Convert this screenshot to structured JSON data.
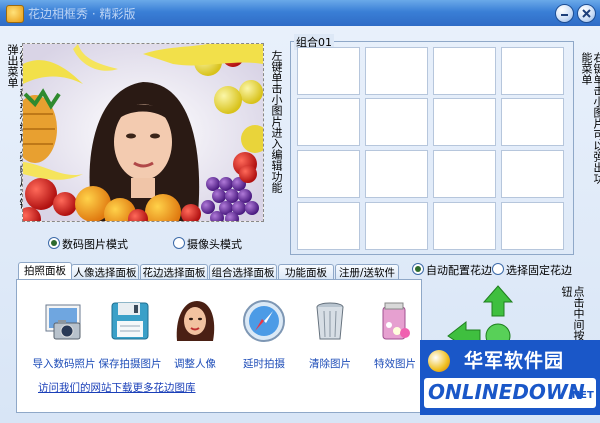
{
  "window": {
    "title": "花边相框秀 · 精彩版"
  },
  "left_hint": "左键可以移动和缩放人物照片右键弹出菜单",
  "mid_hint": "左键单击小图片进入编辑功能",
  "right_hint": "右键单击小图片可以弹出功能菜单",
  "right_hint2": "点击中间按钮",
  "group": {
    "label": "组合01"
  },
  "mode_options": [
    "数码图片模式",
    "摄像头模式"
  ],
  "mode_selected": 0,
  "border_options": [
    "自动配置花边",
    "选择固定花边"
  ],
  "border_selected": 0,
  "tabs": [
    "拍照面板",
    "人像选择面板",
    "花边选择面板",
    "组合选择面板",
    "功能面板",
    "注册/送软件"
  ],
  "tools": [
    {
      "label": "导入数码照片",
      "icon": "camera-icon"
    },
    {
      "label": "保存拍摄图片",
      "icon": "floppy-save-icon"
    },
    {
      "label": "调整人像",
      "icon": "portrait-icon"
    },
    {
      "label": "延时拍摄",
      "icon": "compass-timer-icon"
    },
    {
      "label": "清除图片",
      "icon": "trash-bin-icon"
    },
    {
      "label": "特效图片",
      "icon": "effects-icon"
    }
  ],
  "link_text": "访问我们的网站下载更多花边图库",
  "watermark": {
    "cn": "华军软件园",
    "en": "ONLINEDOWN",
    "net": ".NET"
  },
  "colors": {
    "titlebar": "#3a7fd6",
    "link": "#1a3fb8",
    "watermark_blue": "#1a57c8"
  }
}
